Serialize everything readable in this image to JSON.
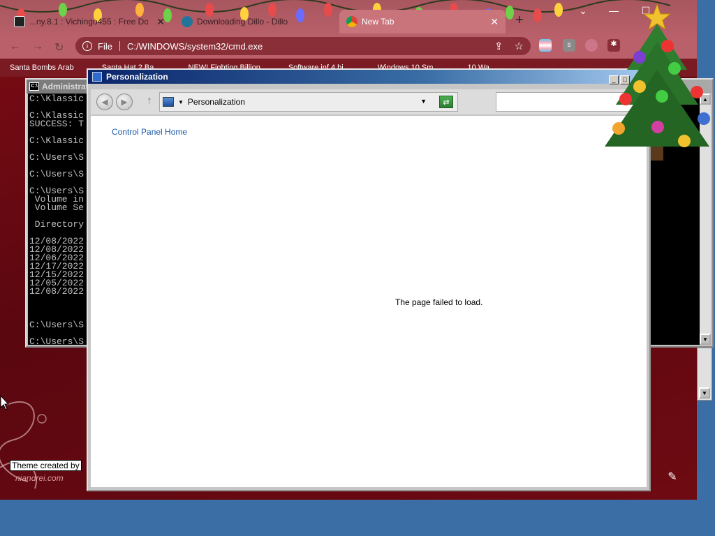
{
  "browser": {
    "tabs": [
      {
        "label": "...ny.8.1 : Vichingo455 : Free Down",
        "icon": "archive-icon",
        "active": false
      },
      {
        "label": "Downloading Dillo - Dillo",
        "icon": "wordpress-icon",
        "active": false
      },
      {
        "label": "New Tab",
        "icon": "chrome-icon",
        "active": true
      }
    ],
    "new_tab_symbol": "+",
    "address": {
      "scheme_label": "File",
      "url": "C:/WINDOWS/system32/cmd.exe"
    },
    "bookmarks": [
      {
        "label": "Santa Bombs Arab"
      },
      {
        "label": "Santa Hat 2 Ba..."
      },
      {
        "label": "NEW! Fighting Billion"
      },
      {
        "label": "Software.inf 4 bi..."
      },
      {
        "label": "Windows 10 Sm..."
      },
      {
        "label": "10 Wa..."
      }
    ],
    "theme_credit": "Theme created by",
    "theme_site": "niandrei.com"
  },
  "cmd": {
    "title": "Administrator",
    "lines": [
      "C:\\Klassic",
      "",
      "C:\\Klassic",
      "SUCCESS: T",
      "",
      "C:\\Klassic",
      "",
      "C:\\Users\\S",
      "",
      "C:\\Users\\S",
      "",
      "C:\\Users\\S",
      " Volume in",
      " Volume Se",
      "",
      " Directory",
      "",
      "12/08/2022",
      "12/08/2022",
      "12/06/2022",
      "12/17/2022",
      "12/15/2022",
      "12/05/2022",
      "12/08/2022",
      "",
      "",
      "",
      "C:\\Users\\S",
      "",
      "C:\\Users\\S"
    ]
  },
  "personalization": {
    "title": "Personalization",
    "breadcrumb": "Personalization",
    "sidebar_link": "Control Panel Home",
    "message": "The page failed to load.",
    "search_value": ""
  }
}
